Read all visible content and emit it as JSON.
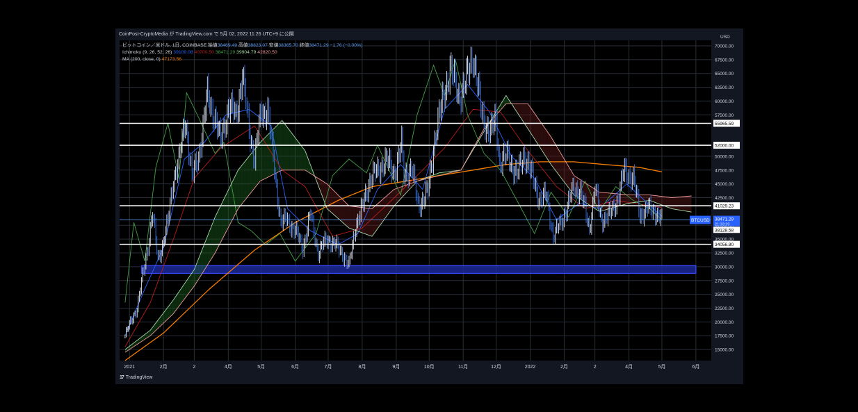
{
  "header": {
    "attribution": "CoinPost-CryptoMedia が TradingView.com で 5月 02, 2022 11:26 UTC+9 に公開"
  },
  "legend": {
    "symbol": "ビットコイン／米ドル, 1日, COINBASE",
    "open_label": "始値",
    "open": "38469.49",
    "high_label": "高値",
    "high": "38823.07",
    "low_label": "安値",
    "low": "38365.70",
    "close_label": "終値",
    "close": "38471.29",
    "change": "−1.76 (−0.00%)",
    "ichimoku_label": "Ichimoku (9, 26, 52, 26)",
    "ichimoku_values": [
      "39109.08",
      "40700.50",
      "38471.29",
      "39904.79",
      "42820.50"
    ],
    "ma_label": "MA (200, close, 0)",
    "ma_value": "47173.56"
  },
  "footer": {
    "logo_text": "TradingView"
  },
  "colors": {
    "background": "#131722",
    "grid": "#2a2e39",
    "text": "#d1d4dc",
    "candle": "#dfe6f5",
    "candle_alt": "#3a6fd8",
    "tenkan": "#2962ff",
    "kijun": "#b71c1c",
    "chikou": "#43a047",
    "senkou_a": "#a5d6a7",
    "senkou_b": "#ef9a9a",
    "ma": "#f57c00",
    "zone": "#1e2aa0",
    "price_badge": "#2962ff"
  },
  "chart_data": {
    "type": "line",
    "title": "ビットコイン／米ドル, 1日, COINBASE",
    "currency": "USD",
    "x_tick_labels": [
      "2021",
      "2月",
      "2",
      "4月",
      "5月",
      "6月",
      "7月",
      "8月",
      "9月",
      "10月",
      "11月",
      "12月",
      "2022",
      "2月",
      "2",
      "4月",
      "5月",
      "6月"
    ],
    "y_ticks": [
      15000,
      17500,
      20000,
      22500,
      25000,
      27500,
      30000,
      32500,
      35000,
      37500,
      42500,
      45000,
      47500,
      50000,
      57500,
      60000,
      62500,
      65000,
      67500,
      70000
    ],
    "ylim": [
      13000,
      71000
    ],
    "grid": true,
    "horizontal_levels": [
      55965.59,
      52000.0,
      41029.23,
      34056.8
    ],
    "level_labels": [
      "55965.59",
      "52000.00",
      "41029.23",
      "34056.80"
    ],
    "support_zone": [
      28800,
      30200
    ],
    "last_price": {
      "symbol": "BTCUSD",
      "value": "38471.29",
      "countdown": "21:33:29"
    },
    "other_axis_labels": [
      "38128.58"
    ],
    "price_series_name": "ビットコイン／米ドル",
    "price_close": [
      [
        "2020-12-28",
        17500
      ],
      [
        "2021-01-01",
        19500
      ],
      [
        "2021-01-08",
        22500
      ],
      [
        "2021-01-12",
        27000
      ],
      [
        "2021-01-18",
        34000
      ],
      [
        "2021-01-22",
        39500
      ],
      [
        "2021-01-27",
        31500
      ],
      [
        "2021-02-01",
        34500
      ],
      [
        "2021-02-05",
        38000
      ],
      [
        "2021-02-10",
        46000
      ],
      [
        "2021-02-15",
        49000
      ],
      [
        "2021-02-21",
        57000
      ],
      [
        "2021-02-27",
        46000
      ],
      [
        "2021-03-05",
        50000
      ],
      [
        "2021-03-13",
        61000
      ],
      [
        "2021-03-20",
        57000
      ],
      [
        "2021-03-25",
        52500
      ],
      [
        "2021-04-01",
        59000
      ],
      [
        "2021-04-08",
        57500
      ],
      [
        "2021-04-14",
        64500
      ],
      [
        "2021-04-20",
        55000
      ],
      [
        "2021-04-25",
        49500
      ],
      [
        "2021-05-01",
        58000
      ],
      [
        "2021-05-07",
        58500
      ],
      [
        "2021-05-12",
        49500
      ],
      [
        "2021-05-19",
        38000
      ],
      [
        "2021-05-25",
        38500
      ],
      [
        "2021-06-01",
        36500
      ],
      [
        "2021-06-08",
        33500
      ],
      [
        "2021-06-15",
        39500
      ],
      [
        "2021-06-22",
        32500
      ],
      [
        "2021-06-30",
        35000
      ],
      [
        "2021-07-07",
        34000
      ],
      [
        "2021-07-14",
        32500
      ],
      [
        "2021-07-20",
        30000
      ],
      [
        "2021-07-26",
        37500
      ],
      [
        "2021-08-01",
        40500
      ],
      [
        "2021-08-09",
        46500
      ],
      [
        "2021-08-15",
        47000
      ],
      [
        "2021-08-22",
        49500
      ],
      [
        "2021-08-30",
        47000
      ],
      [
        "2021-09-06",
        52000
      ],
      [
        "2021-09-08",
        46500
      ],
      [
        "2021-09-15",
        48000
      ],
      [
        "2021-09-21",
        41000
      ],
      [
        "2021-09-30",
        43500
      ],
      [
        "2021-10-07",
        54500
      ],
      [
        "2021-10-15",
        61500
      ],
      [
        "2021-10-20",
        66000
      ],
      [
        "2021-10-28",
        61000
      ],
      [
        "2021-11-03",
        63000
      ],
      [
        "2021-11-10",
        68500
      ],
      [
        "2021-11-18",
        57500
      ],
      [
        "2021-11-26",
        54000
      ],
      [
        "2021-12-01",
        57000
      ],
      [
        "2021-12-04",
        49000
      ],
      [
        "2021-12-12",
        50000
      ],
      [
        "2021-12-20",
        46500
      ],
      [
        "2021-12-27",
        50500
      ],
      [
        "2022-01-01",
        47500
      ],
      [
        "2022-01-10",
        42000
      ],
      [
        "2022-01-16",
        43000
      ],
      [
        "2022-01-22",
        35500
      ],
      [
        "2022-01-28",
        37500
      ],
      [
        "2022-02-05",
        41500
      ],
      [
        "2022-02-10",
        44500
      ],
      [
        "2022-02-16",
        43500
      ],
      [
        "2022-02-24",
        37000
      ],
      [
        "2022-03-01",
        44000
      ],
      [
        "2022-03-07",
        38500
      ],
      [
        "2022-03-15",
        39500
      ],
      [
        "2022-03-22",
        42500
      ],
      [
        "2022-03-28",
        47500
      ],
      [
        "2022-04-05",
        46000
      ],
      [
        "2022-04-11",
        39500
      ],
      [
        "2022-04-18",
        40500
      ],
      [
        "2022-04-25",
        40000
      ],
      [
        "2022-05-01",
        38471
      ]
    ],
    "series": [
      {
        "name": "MA (200, close, 0)",
        "color_key": "ma",
        "points": [
          [
            "2020-12-28",
            13000
          ],
          [
            "2021-02-01",
            18000
          ],
          [
            "2021-03-15",
            26000
          ],
          [
            "2021-04-25",
            33000
          ],
          [
            "2021-06-01",
            38000
          ],
          [
            "2021-07-10",
            42000
          ],
          [
            "2021-08-10",
            44500
          ],
          [
            "2021-09-10",
            45500
          ],
          [
            "2021-10-10",
            46500
          ],
          [
            "2021-11-10",
            47500
          ],
          [
            "2021-12-10",
            48500
          ],
          [
            "2022-01-10",
            49000
          ],
          [
            "2022-02-10",
            49000
          ],
          [
            "2022-03-10",
            48500
          ],
          [
            "2022-04-10",
            48000
          ],
          [
            "2022-05-01",
            47173.56
          ]
        ]
      },
      {
        "name": "Tenkan",
        "color_key": "tenkan",
        "points": [
          [
            "2020-12-28",
            17500
          ],
          [
            "2021-01-15",
            26000
          ],
          [
            "2021-02-01",
            33500
          ],
          [
            "2021-02-20",
            49500
          ],
          [
            "2021-03-10",
            52500
          ],
          [
            "2021-03-30",
            57500
          ],
          [
            "2021-04-20",
            58500
          ],
          [
            "2021-05-10",
            55500
          ],
          [
            "2021-05-25",
            40500
          ],
          [
            "2021-06-15",
            36500
          ],
          [
            "2021-07-10",
            34000
          ],
          [
            "2021-07-28",
            36000
          ],
          [
            "2021-08-15",
            44000
          ],
          [
            "2021-09-05",
            48500
          ],
          [
            "2021-09-25",
            44000
          ],
          [
            "2021-10-15",
            58500
          ],
          [
            "2021-11-05",
            63000
          ],
          [
            "2021-11-25",
            58000
          ],
          [
            "2021-12-15",
            50000
          ],
          [
            "2022-01-05",
            46000
          ],
          [
            "2022-01-25",
            38500
          ],
          [
            "2022-02-15",
            41500
          ],
          [
            "2022-03-05",
            40500
          ],
          [
            "2022-03-30",
            45000
          ],
          [
            "2022-05-01",
            39109.08
          ]
        ]
      },
      {
        "name": "Kijun",
        "color_key": "kijun",
        "points": [
          [
            "2020-12-28",
            15500
          ],
          [
            "2021-01-20",
            23500
          ],
          [
            "2021-02-10",
            35000
          ],
          [
            "2021-03-01",
            46000
          ],
          [
            "2021-03-25",
            51500
          ],
          [
            "2021-04-25",
            55500
          ],
          [
            "2021-05-20",
            47500
          ],
          [
            "2021-06-10",
            44500
          ],
          [
            "2021-07-05",
            35500
          ],
          [
            "2021-08-01",
            37000
          ],
          [
            "2021-08-25",
            41500
          ],
          [
            "2021-09-20",
            46500
          ],
          [
            "2021-10-15",
            51500
          ],
          [
            "2021-11-10",
            58500
          ],
          [
            "2021-12-05",
            58000
          ],
          [
            "2021-12-30",
            51000
          ],
          [
            "2022-01-25",
            44500
          ],
          [
            "2022-02-20",
            40500
          ],
          [
            "2022-03-20",
            42000
          ],
          [
            "2022-05-01",
            40700.5
          ]
        ]
      },
      {
        "name": "Chikou",
        "color_key": "chikou",
        "points": [
          [
            "2020-12-28",
            23500
          ],
          [
            "2021-01-05",
            38000
          ],
          [
            "2021-01-15",
            31000
          ],
          [
            "2021-01-25",
            48000
          ],
          [
            "2021-02-05",
            56000
          ],
          [
            "2021-02-15",
            46000
          ],
          [
            "2021-02-22",
            61500
          ],
          [
            "2021-03-05",
            57000
          ],
          [
            "2021-03-20",
            50500
          ],
          [
            "2021-03-28",
            52500
          ],
          [
            "2021-04-10",
            38000
          ],
          [
            "2021-04-22",
            36500
          ],
          [
            "2021-05-05",
            34000
          ],
          [
            "2021-05-18",
            36000
          ],
          [
            "2021-06-01",
            31000
          ],
          [
            "2021-06-20",
            36000
          ],
          [
            "2021-07-05",
            46500
          ],
          [
            "2021-07-20",
            49500
          ],
          [
            "2021-08-05",
            47000
          ],
          [
            "2021-08-15",
            52000
          ],
          [
            "2021-09-05",
            43000
          ],
          [
            "2021-09-20",
            57500
          ],
          [
            "2021-10-05",
            66500
          ],
          [
            "2021-10-15",
            61000
          ],
          [
            "2021-10-25",
            67500
          ],
          [
            "2021-11-05",
            57500
          ],
          [
            "2021-11-20",
            50500
          ],
          [
            "2021-12-05",
            47500
          ],
          [
            "2021-12-20",
            42000
          ],
          [
            "2022-01-05",
            36000
          ],
          [
            "2022-01-20",
            43500
          ],
          [
            "2022-02-05",
            39000
          ],
          [
            "2022-02-20",
            45500
          ],
          [
            "2022-03-05",
            40000
          ],
          [
            "2022-03-20",
            44500
          ],
          [
            "2022-04-05",
            42000
          ],
          [
            "2022-04-20",
            40500
          ],
          [
            "2022-05-01",
            38471.29
          ]
        ]
      },
      {
        "name": "Senkou A",
        "color_key": "senkou_a",
        "points": [
          [
            "2020-12-28",
            15000
          ],
          [
            "2021-01-20",
            18500
          ],
          [
            "2021-02-10",
            24000
          ],
          [
            "2021-03-01",
            29500
          ],
          [
            "2021-03-20",
            39000
          ],
          [
            "2021-04-10",
            47500
          ],
          [
            "2021-04-30",
            52500
          ],
          [
            "2021-05-20",
            56500
          ],
          [
            "2021-06-10",
            51000
          ],
          [
            "2021-06-30",
            40500
          ],
          [
            "2021-07-20",
            37000
          ],
          [
            "2021-08-10",
            35500
          ],
          [
            "2021-08-30",
            41000
          ],
          [
            "2021-09-20",
            45500
          ],
          [
            "2021-10-10",
            47000
          ],
          [
            "2021-10-30",
            47500
          ],
          [
            "2021-11-20",
            54500
          ],
          [
            "2021-12-10",
            61000
          ],
          [
            "2021-12-30",
            55000
          ],
          [
            "2022-01-20",
            48500
          ],
          [
            "2022-02-10",
            43000
          ],
          [
            "2022-03-05",
            40000
          ],
          [
            "2022-04-01",
            41500
          ],
          [
            "2022-04-20",
            42000
          ],
          [
            "2022-05-10",
            40500
          ],
          [
            "2022-05-28",
            39904.79
          ]
        ]
      },
      {
        "name": "Senkou B",
        "color_key": "senkou_b",
        "points": [
          [
            "2020-12-28",
            14500
          ],
          [
            "2021-01-20",
            17500
          ],
          [
            "2021-02-10",
            21500
          ],
          [
            "2021-03-01",
            26500
          ],
          [
            "2021-03-20",
            32500
          ],
          [
            "2021-04-10",
            40500
          ],
          [
            "2021-04-30",
            45500
          ],
          [
            "2021-05-20",
            47500
          ],
          [
            "2021-06-10",
            47500
          ],
          [
            "2021-06-30",
            45000
          ],
          [
            "2021-07-20",
            41000
          ],
          [
            "2021-08-10",
            40500
          ],
          [
            "2021-08-30",
            44000
          ],
          [
            "2021-09-20",
            45500
          ],
          [
            "2021-10-10",
            46500
          ],
          [
            "2021-10-30",
            47500
          ],
          [
            "2021-11-20",
            55000
          ],
          [
            "2021-12-10",
            59500
          ],
          [
            "2021-12-30",
            59500
          ],
          [
            "2022-01-20",
            53500
          ],
          [
            "2022-02-10",
            46500
          ],
          [
            "2022-03-05",
            43500
          ],
          [
            "2022-04-01",
            43000
          ],
          [
            "2022-04-20",
            43000
          ],
          [
            "2022-05-10",
            42500
          ],
          [
            "2022-05-28",
            42820.5
          ]
        ]
      }
    ]
  }
}
